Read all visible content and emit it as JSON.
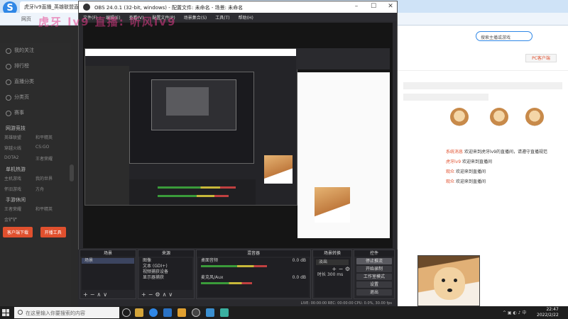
{
  "browser": {
    "tab_title": "虎牙lv9直播_英雄联盟直播",
    "address_hint": "网页",
    "sidebar": {
      "items": [
        "我的关注",
        "排行榜",
        "直播分类",
        "分类页",
        "赛事"
      ],
      "section1_title": "网游竞技",
      "section1_links": [
        "英雄联盟",
        "和平精英",
        "穿越火线",
        "CS:GO",
        "DOTA2",
        "王者荣耀"
      ],
      "section2_title": "单机热游",
      "section2_links": [
        "主机游戏",
        "我的世界",
        "怀旧游戏",
        "方舟"
      ],
      "section3_title": "手游休闲",
      "section3_links": [
        "王者荣耀",
        "和平精英",
        "金铲铲"
      ],
      "buttons": [
        "客户端下载",
        "开播工具"
      ]
    },
    "right_panel": {
      "search_placeholder": "搜索主播或游戏",
      "pc_button": "PC客户端",
      "chat": [
        {
          "user": "系统消息",
          "text": "欢迎来到虎牙lv9的直播间，请遵守直播规范"
        },
        {
          "user": "虎牙lv9",
          "text": "欢迎来到直播间"
        },
        {
          "user": "观众",
          "text": "欢迎来到直播间"
        },
        {
          "user": "观众",
          "text": "欢迎来到直播间"
        }
      ]
    }
  },
  "obs": {
    "title": "OBS 24.0.1 (32-bit, windows) - 配置文件: 未命名 - 场景: 未命名",
    "menu": [
      "文件(F)",
      "编辑(E)",
      "查看(V)",
      "配置文件(P)",
      "场景集合(S)",
      "工具(T)",
      "帮助(H)"
    ],
    "docks": {
      "scenes": {
        "title": "场景",
        "items": [
          "场景"
        ]
      },
      "sources": {
        "title": "来源",
        "items": [
          "图像",
          "文本 (GDI+)",
          "视频捕获设备",
          "显示器捕获"
        ]
      },
      "mixer": {
        "title": "混音器",
        "tracks": [
          {
            "name": "桌面音频",
            "db": "0.0 dB",
            "level": 0.62
          },
          {
            "name": "麦克风/Aux",
            "db": "0.0 dB",
            "level": 0.48
          }
        ]
      },
      "transitions": {
        "title": "场景转换",
        "type": "淡出",
        "duration_label": "时长",
        "duration": "300 ms"
      },
      "controls": {
        "title": "控件",
        "buttons": [
          "停止推流",
          "开始录制",
          "工作室模式",
          "设置",
          "退出"
        ]
      }
    },
    "status": "LIVE: 00:00:00   REC: 00:00:00   CPU: 0.0%, 30.00 fps"
  },
  "watermark": "虎牙 lv9  直播: 听风lv9",
  "taskbar": {
    "search_placeholder": "在这里输入你要搜索的内容",
    "time": "22:47",
    "date": "2022/2/22"
  }
}
